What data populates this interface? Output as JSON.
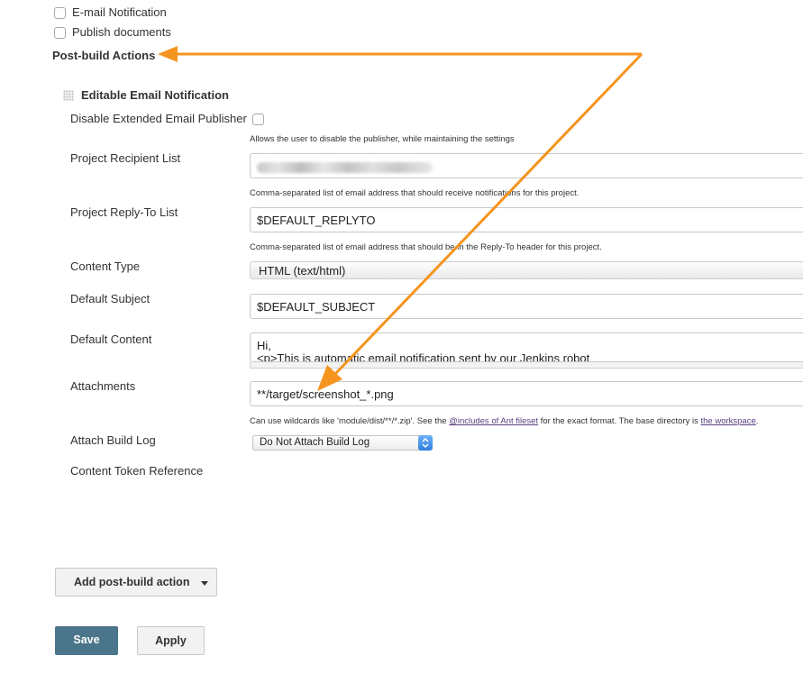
{
  "top_options": [
    {
      "label": "E-mail Notification",
      "checked": false
    },
    {
      "label": "Publish documents",
      "checked": false
    }
  ],
  "post_build": {
    "title": "Post-build Actions",
    "publisher_title": "Editable Email Notification",
    "fields": {
      "disable_label": "Disable Extended Email Publisher",
      "disable_help": "Allows the user to disable the publisher, while maintaining the settings",
      "recipient_label": "Project Recipient List",
      "recipient_help": "Comma-separated list of email address that should receive notifications for this project.",
      "replyto_label": "Project Reply-To List",
      "replyto_value": "$DEFAULT_REPLYTO",
      "replyto_help": "Comma-separated list of email address that should be in the Reply-To header for this project.",
      "content_type_label": "Content Type",
      "content_type_value": "HTML (text/html)",
      "subject_label": "Default Subject",
      "subject_value": "$DEFAULT_SUBJECT",
      "content_label": "Default Content",
      "content_line1": "Hi,",
      "content_line2": "<p>This is automatic email notification sent by our Jenkins robot",
      "attachments_label": "Attachments",
      "attachments_value": "**/target/screenshot_*.png",
      "attachments_help_1": "Can use wildcards like 'module/dist/**/*.zip'. See the ",
      "attachments_help_link1": "@includes of Ant fileset",
      "attachments_help_2": " for the exact format. The base directory is ",
      "attachments_help_link2": "the workspace",
      "attachments_help_3": ".",
      "attach_log_label": "Attach Build Log",
      "attach_log_value": "Do Not Attach Build Log",
      "token_label": "Content Token Reference"
    }
  },
  "buttons": {
    "add_post_build": "Add post-build action",
    "save": "Save",
    "apply": "Apply"
  },
  "colors": {
    "annotation_arrow": "#f5941f",
    "save_button": "#4b758b"
  },
  "icons": {
    "drag_handle": "grip-icon",
    "dropdown": "caret-down-icon",
    "select_arrows": "updown-arrows-icon"
  }
}
